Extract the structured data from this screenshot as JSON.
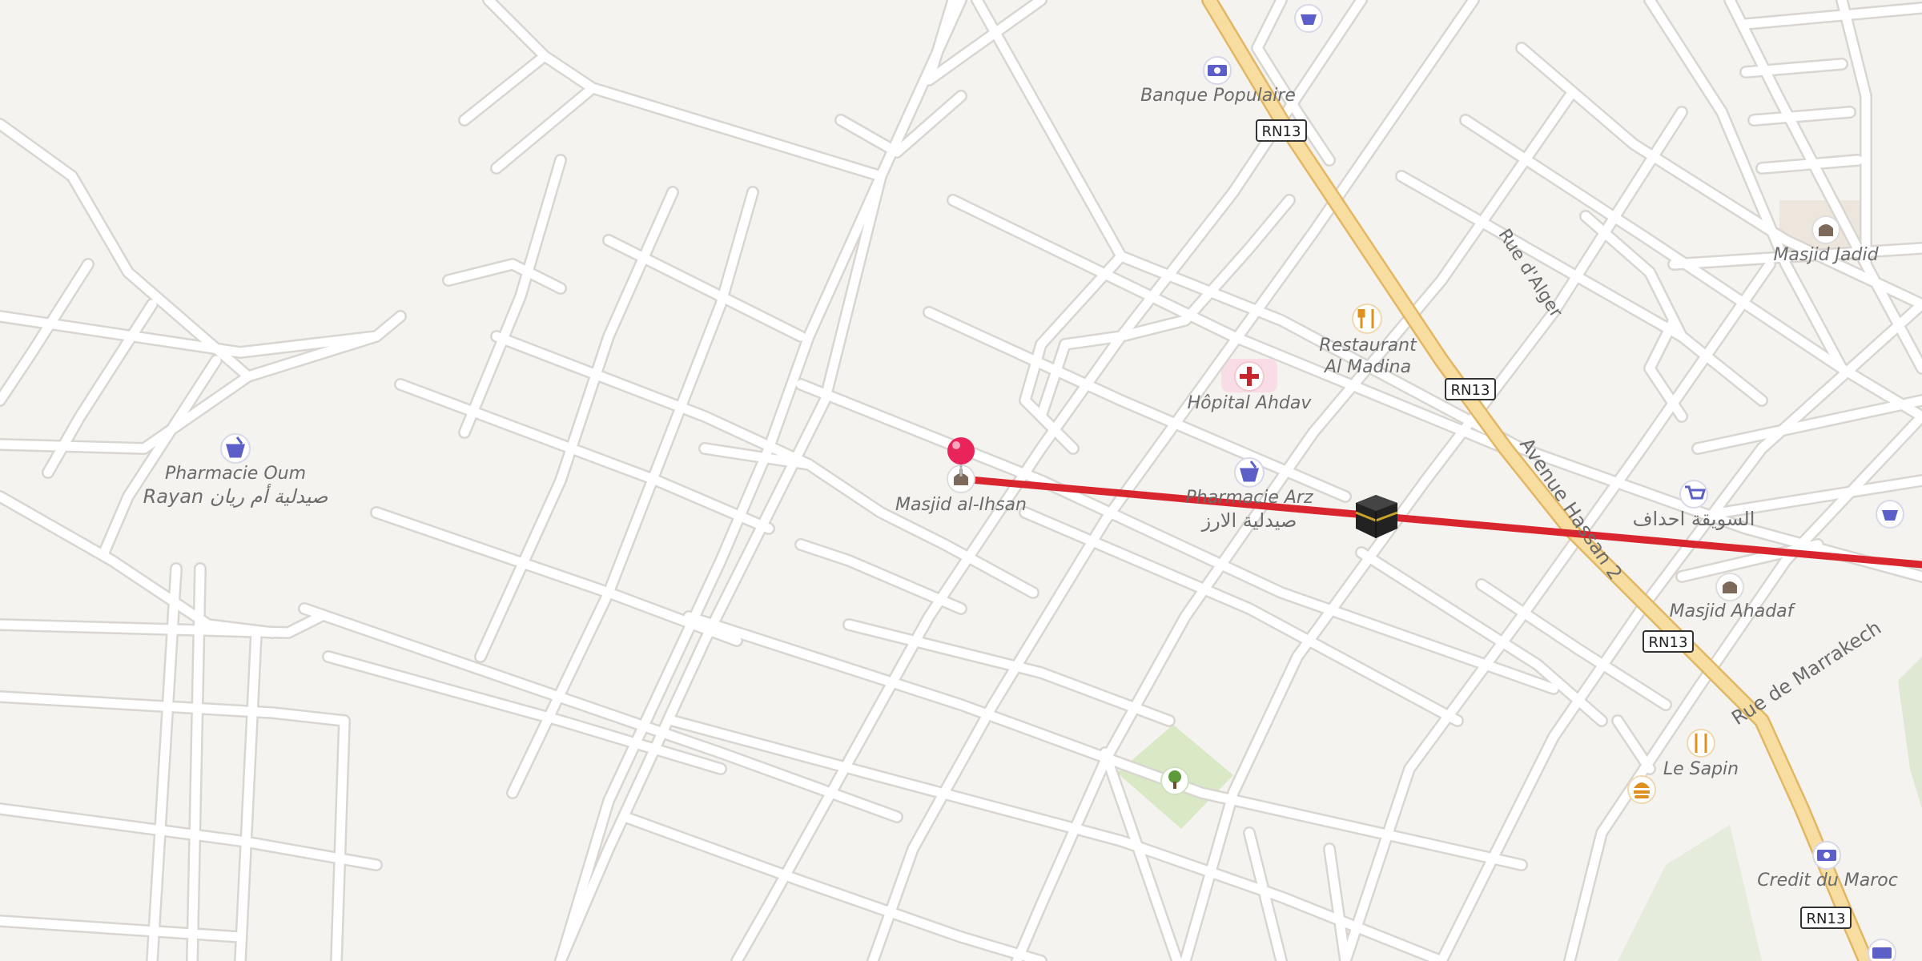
{
  "map": {
    "pois": {
      "banque_populaire": "Banque Populaire",
      "restaurant_al_madina_1": "Restaurant",
      "restaurant_al_madina_2": "Al Madina",
      "hopital_ahdav": "Hôpital Ahdav",
      "pharmacie_arz_1": "Pharmacie Arz",
      "pharmacie_arz_2": "صيدلية الارز",
      "masjid_al_ihsan": "Masjid al-Ihsan",
      "pharmacie_oum_rayan_1": "Pharmacie Oum",
      "pharmacie_oum_rayan_2": "Rayan صيدلية أم ريان",
      "masjid_jadid": "Masjid Jadid",
      "souiqa": "السويقة احداف",
      "masjid_ahadaf": "Masjid Ahadaf",
      "le_sapin": "Le Sapin",
      "credit_du_maroc": "Credit du Maroc"
    },
    "streets": {
      "rue_d_alger": "Rue d'Alger",
      "avenue_hassan_2": "Avenue Hassan 2",
      "rue_de_marrakech": "Rue de Marrakech"
    },
    "road_shields": [
      "RN13",
      "RN13",
      "RN13",
      "RN13"
    ],
    "colors": {
      "background": "#f4f3f0",
      "road": "#ffffff",
      "road_casing": "#d9d6d1",
      "main_road": "#f7dda0",
      "main_road_casing": "#e2b764",
      "qibla_line": "#d9262e",
      "pin": "#e8245a",
      "park": "#d9e8c5",
      "poi_blue": "#5b5fc7",
      "poi_orange": "#e0901e",
      "poi_brown": "#7d6a5a",
      "hospital_red": "#c8262e",
      "label_gray": "#6b6b6b"
    },
    "icons": [
      "basket-icon",
      "banknote-icon",
      "fork-knife-icon",
      "hospital-cross-icon",
      "pharmacy-mortar-icon",
      "mosque-icon",
      "kaaba-icon",
      "shopping-cart-icon",
      "burger-icon",
      "tree-icon",
      "location-pin-icon"
    ]
  }
}
